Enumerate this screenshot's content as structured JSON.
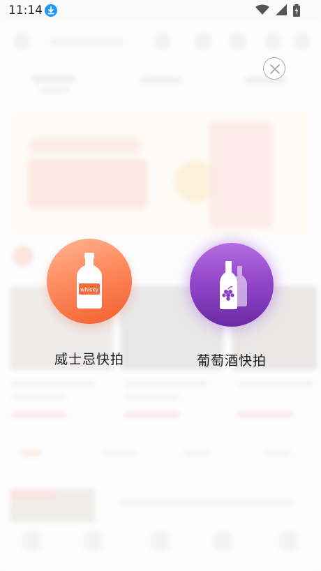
{
  "status_bar": {
    "time": "11:14",
    "download_icon": "download-icon",
    "icons": [
      "wifi-icon",
      "signal-icon",
      "battery-charging-icon"
    ]
  },
  "overlay": {
    "close_icon": "close-icon",
    "options": [
      {
        "label": "威士忌快拍",
        "icon": "whisky-bottle-icon",
        "bottle_text": "whisky",
        "color": "#f26a3c"
      },
      {
        "label": "葡萄酒快拍",
        "icon": "wine-bottles-icon",
        "color": "#8e43c4"
      }
    ]
  }
}
